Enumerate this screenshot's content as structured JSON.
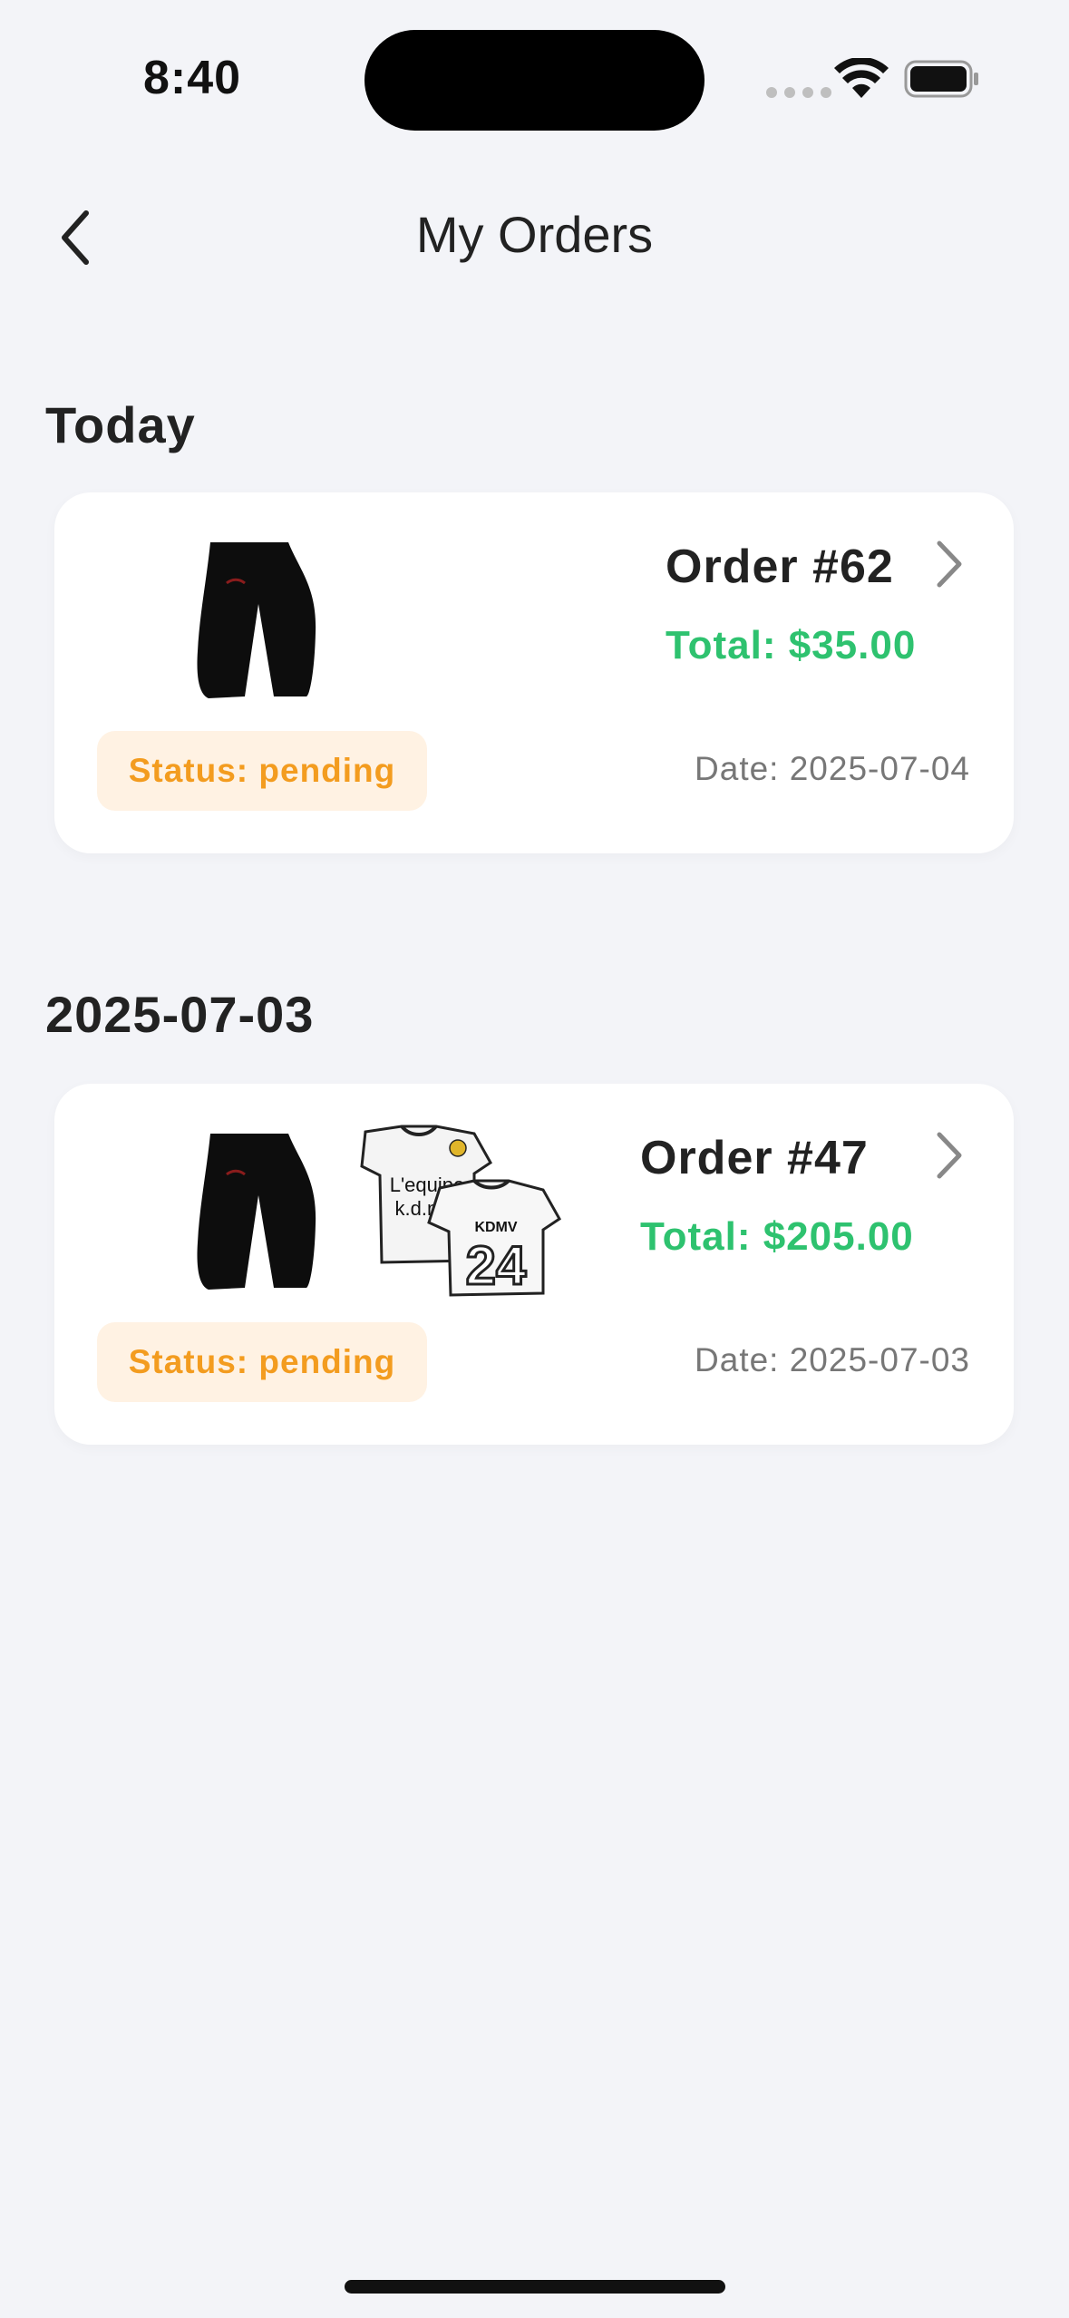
{
  "status_bar": {
    "time": "8:40"
  },
  "header": {
    "title": "My Orders"
  },
  "sections": [
    {
      "label": "Today",
      "order": {
        "number": "Order #62",
        "total": "Total: $35.00",
        "status": "Status: pending",
        "date": "Date: 2025-07-04",
        "items": [
          "black-pants-thumbnail"
        ]
      }
    },
    {
      "label": "2025-07-03",
      "order": {
        "number": "Order #47",
        "total": "Total: $205.00",
        "status": "Status: pending",
        "date": "Date: 2025-07-03",
        "items": [
          "black-pants-thumbnail",
          "football-jersey-thumbnail"
        ],
        "jersey_text": {
          "front_line1": "L'equipe",
          "front_line2": "k.d.m.v",
          "back_name": "KDMV",
          "back_number": "24"
        }
      }
    }
  ],
  "colors": {
    "background": "#f3f4f8",
    "card": "#ffffff",
    "total_green": "#2ec26f",
    "status_orange": "#f39c1f",
    "status_badge_bg": "#fff2e3"
  }
}
